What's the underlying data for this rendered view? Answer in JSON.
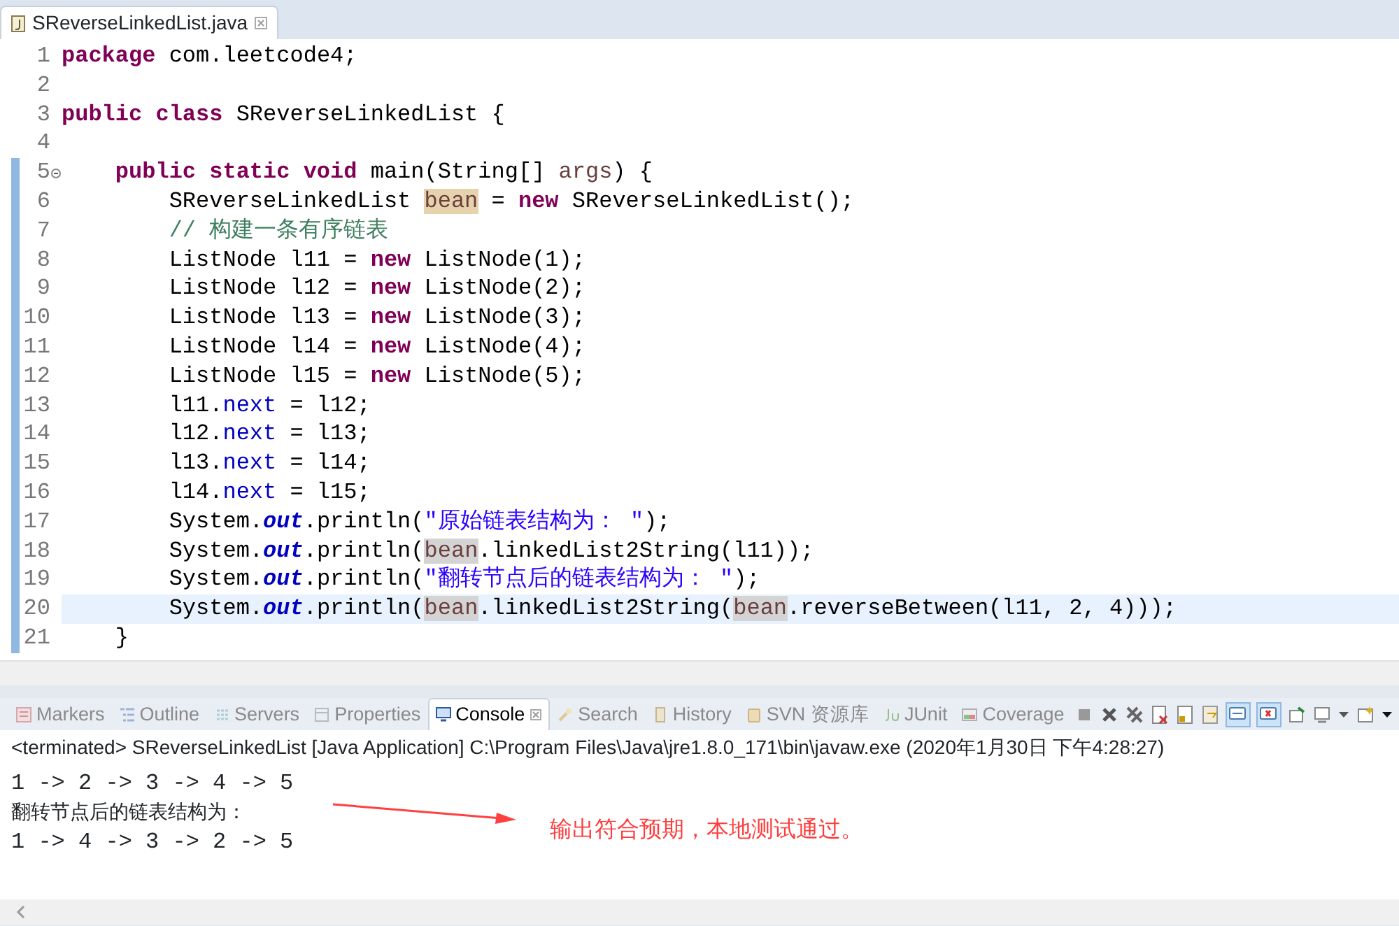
{
  "editor": {
    "tab": {
      "title": "SReverseLinkedList.java",
      "selected": true
    },
    "lines": [
      {
        "number": "1",
        "fold": false,
        "changed": false,
        "current": false,
        "tokens": [
          {
            "kind": "kw",
            "text": "package"
          },
          {
            "kind": "plain",
            "text": " com.leetcode4;"
          }
        ]
      },
      {
        "number": "2",
        "fold": false,
        "changed": false,
        "current": false
      },
      {
        "number": "3",
        "fold": false,
        "changed": false,
        "current": false,
        "tokens": [
          {
            "kind": "kw",
            "text": "public class"
          },
          {
            "kind": "plain",
            "text": " SReverseLinkedList {"
          }
        ]
      },
      {
        "number": "4",
        "fold": false,
        "changed": false,
        "current": false
      },
      {
        "number": "5",
        "fold": true,
        "changed": true,
        "current": false,
        "tokens": [
          {
            "kind": "kw",
            "text": "    public static void"
          },
          {
            "kind": "plain",
            "text": " main(String[] "
          },
          {
            "kind": "param",
            "text": "args"
          },
          {
            "kind": "plain",
            "text": ") {"
          }
        ]
      },
      {
        "number": "6",
        "fold": false,
        "changed": true,
        "current": false,
        "tokens": [
          {
            "kind": "plain",
            "text": "        SReverseLinkedList "
          },
          {
            "kind": "occ_write",
            "text": "bean"
          },
          {
            "kind": "plain",
            "text": " = "
          },
          {
            "kind": "kw",
            "text": "new"
          },
          {
            "kind": "plain",
            "text": " SReverseLinkedList();"
          }
        ]
      },
      {
        "number": "7",
        "fold": false,
        "changed": true,
        "current": false,
        "tokens": [
          {
            "kind": "comment",
            "text": "        // 构建一条有序链表"
          }
        ]
      },
      {
        "number": "8",
        "fold": false,
        "changed": true,
        "current": false,
        "tokens": [
          {
            "kind": "plain",
            "text": "        ListNode l11 = "
          },
          {
            "kind": "kw",
            "text": "new"
          },
          {
            "kind": "plain",
            "text": " ListNode(1);"
          }
        ]
      },
      {
        "number": "9",
        "fold": false,
        "changed": true,
        "current": false,
        "tokens": [
          {
            "kind": "plain",
            "text": "        ListNode l12 = "
          },
          {
            "kind": "kw",
            "text": "new"
          },
          {
            "kind": "plain",
            "text": " ListNode(2);"
          }
        ]
      },
      {
        "number": "10",
        "fold": false,
        "changed": true,
        "current": false,
        "tokens": [
          {
            "kind": "plain",
            "text": "        ListNode l13 = "
          },
          {
            "kind": "kw",
            "text": "new"
          },
          {
            "kind": "plain",
            "text": " ListNode(3);"
          }
        ]
      },
      {
        "number": "11",
        "fold": false,
        "changed": true,
        "current": false,
        "tokens": [
          {
            "kind": "plain",
            "text": "        ListNode l14 = "
          },
          {
            "kind": "kw",
            "text": "new"
          },
          {
            "kind": "plain",
            "text": " ListNode(4);"
          }
        ]
      },
      {
        "number": "12",
        "fold": false,
        "changed": true,
        "current": false,
        "tokens": [
          {
            "kind": "plain",
            "text": "        ListNode l15 = "
          },
          {
            "kind": "kw",
            "text": "new"
          },
          {
            "kind": "plain",
            "text": " ListNode(5);"
          }
        ]
      },
      {
        "number": "13",
        "fold": false,
        "changed": true,
        "current": false,
        "tokens": [
          {
            "kind": "plain",
            "text": "        l11."
          },
          {
            "kind": "field",
            "text": "next"
          },
          {
            "kind": "plain",
            "text": " = l12;"
          }
        ]
      },
      {
        "number": "14",
        "fold": false,
        "changed": true,
        "current": false,
        "tokens": [
          {
            "kind": "plain",
            "text": "        l12."
          },
          {
            "kind": "field",
            "text": "next"
          },
          {
            "kind": "plain",
            "text": " = l13;"
          }
        ]
      },
      {
        "number": "15",
        "fold": false,
        "changed": true,
        "current": false,
        "tokens": [
          {
            "kind": "plain",
            "text": "        l13."
          },
          {
            "kind": "field",
            "text": "next"
          },
          {
            "kind": "plain",
            "text": " = l14;"
          }
        ]
      },
      {
        "number": "16",
        "fold": false,
        "changed": true,
        "current": false,
        "tokens": [
          {
            "kind": "plain",
            "text": "        l14."
          },
          {
            "kind": "field",
            "text": "next"
          },
          {
            "kind": "plain",
            "text": " = l15;"
          }
        ]
      },
      {
        "number": "17",
        "fold": false,
        "changed": true,
        "current": false,
        "tokens": [
          {
            "kind": "plain",
            "text": "        System."
          },
          {
            "kind": "static",
            "text": "out"
          },
          {
            "kind": "plain",
            "text": ".println("
          },
          {
            "kind": "string",
            "text": "\"原始链表结构为： \""
          },
          {
            "kind": "plain",
            "text": ");"
          }
        ]
      },
      {
        "number": "18",
        "fold": false,
        "changed": true,
        "current": false,
        "tokens": [
          {
            "kind": "plain",
            "text": "        System."
          },
          {
            "kind": "static",
            "text": "out"
          },
          {
            "kind": "plain",
            "text": ".println("
          },
          {
            "kind": "occ",
            "text": "bean"
          },
          {
            "kind": "plain",
            "text": ".linkedList2String(l11));"
          }
        ]
      },
      {
        "number": "19",
        "fold": false,
        "changed": true,
        "current": false,
        "tokens": [
          {
            "kind": "plain",
            "text": "        System."
          },
          {
            "kind": "static",
            "text": "out"
          },
          {
            "kind": "plain",
            "text": ".println("
          },
          {
            "kind": "string",
            "text": "\"翻转节点后的链表结构为： \""
          },
          {
            "kind": "plain",
            "text": ");"
          }
        ]
      },
      {
        "number": "20",
        "fold": false,
        "changed": true,
        "current": true,
        "tokens": [
          {
            "kind": "plain",
            "text": "        System."
          },
          {
            "kind": "static",
            "text": "out"
          },
          {
            "kind": "plain",
            "text": ".println("
          },
          {
            "kind": "occ",
            "text": "bean"
          },
          {
            "kind": "plain",
            "text": ".linkedList2String("
          },
          {
            "kind": "occ",
            "text": "bean"
          },
          {
            "kind": "plain",
            "text": ".reverseBetween(l11, 2, 4)));"
          }
        ]
      },
      {
        "number": "21",
        "fold": false,
        "changed": true,
        "current": false,
        "tokens": [
          {
            "kind": "plain",
            "text": "    }"
          }
        ]
      }
    ]
  },
  "views": {
    "tabs": [
      {
        "label": "Markers",
        "selected": false
      },
      {
        "label": "Outline",
        "selected": false
      },
      {
        "label": "Servers",
        "selected": false
      },
      {
        "label": "Properties",
        "selected": false
      },
      {
        "label": "Console",
        "selected": true
      },
      {
        "label": "Search",
        "selected": false
      },
      {
        "label": "History",
        "selected": false
      },
      {
        "label": "SVN 资源库",
        "selected": false
      },
      {
        "label": "JUnit",
        "selected": false
      },
      {
        "label": "Coverage",
        "selected": false
      }
    ],
    "toolbar_toggles": [
      {
        "selected": true
      },
      {
        "selected": true
      }
    ]
  },
  "console": {
    "status": "<terminated> SReverseLinkedList [Java Application] C:\\Program Files\\Java\\jre1.8.0_171\\bin\\javaw.exe (2020年1月30日 下午4:28:27)",
    "output": [
      {
        "kind": "mono",
        "text": "1 -> 2 -> 3 -> 4 -> 5"
      },
      {
        "kind": "cjk",
        "text": "翻转节点后的链表结构为："
      },
      {
        "kind": "mono",
        "text": "1 -> 4 -> 3 -> 2 -> 5"
      }
    ],
    "annotation": "输出符合预期，本地测试通过。"
  }
}
